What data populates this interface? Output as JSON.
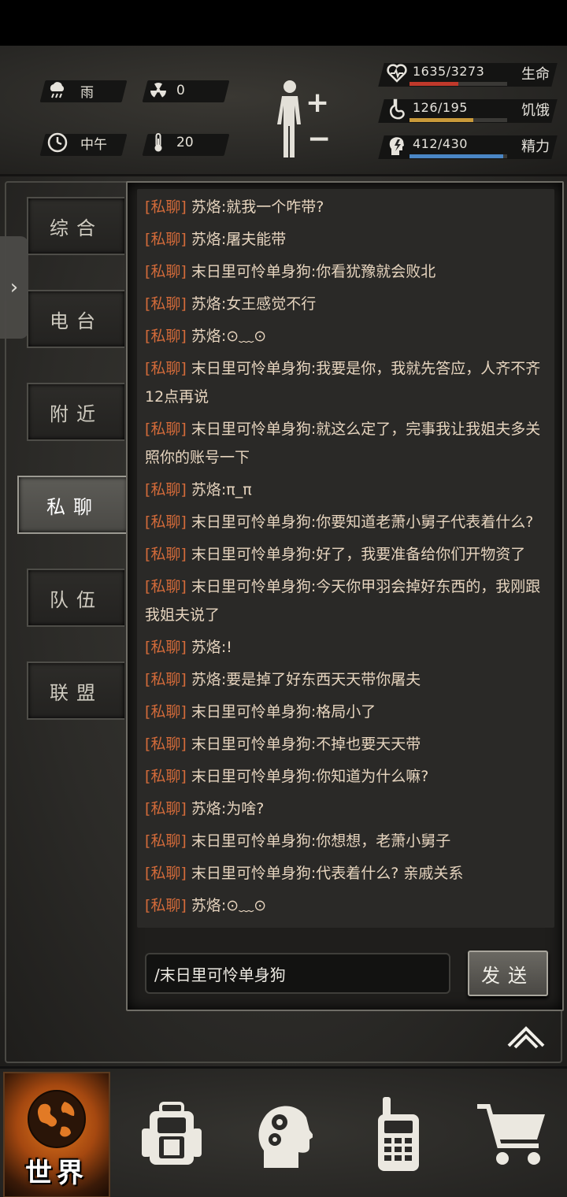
{
  "hud": {
    "weather": {
      "icon": "cloud-rain-icon",
      "value": "雨"
    },
    "radiation": {
      "icon": "radiation-icon",
      "value": "0"
    },
    "time": {
      "icon": "clock-icon",
      "value": "中午"
    },
    "temperature": {
      "icon": "thermometer-icon",
      "value": "20"
    },
    "stats": [
      {
        "key": "health",
        "icon": "heart-icon",
        "value": "1635/3273",
        "label": "生命",
        "fraction": 0.5,
        "color": "#c0392b"
      },
      {
        "key": "hunger",
        "icon": "stomach-icon",
        "value": "126/195",
        "label": "饥饿",
        "fraction": 0.65,
        "color": "#c99a3a"
      },
      {
        "key": "energy",
        "icon": "lightning-head-icon",
        "value": "412/430",
        "label": "精力",
        "fraction": 0.96,
        "color": "#4a86c5"
      }
    ]
  },
  "tabs": [
    {
      "label": "综合",
      "active": false
    },
    {
      "label": "电台",
      "active": false
    },
    {
      "label": "附近",
      "active": false
    },
    {
      "label": "私聊",
      "active": true
    },
    {
      "label": "队伍",
      "active": false
    },
    {
      "label": "联盟",
      "active": false
    }
  ],
  "chat": {
    "messages": [
      {
        "tag": "[私聊]",
        "text": "苏烙:就我一个咋带?"
      },
      {
        "tag": "[私聊]",
        "text": "苏烙:屠夫能带"
      },
      {
        "tag": "[私聊]",
        "text": "末日里可怜单身狗:你看犹豫就会败北"
      },
      {
        "tag": "[私聊]",
        "text": "苏烙:女王感觉不行"
      },
      {
        "tag": "[私聊]",
        "text": "苏烙:⊙﹏⊙"
      },
      {
        "tag": "[私聊]",
        "text": "末日里可怜单身狗:我要是你，我就先答应，人齐不齐12点再说"
      },
      {
        "tag": "[私聊]",
        "text": "末日里可怜单身狗:就这么定了，完事我让我姐夫多关照你的账号一下"
      },
      {
        "tag": "[私聊]",
        "text": "苏烙:π_π"
      },
      {
        "tag": "[私聊]",
        "text": "末日里可怜单身狗:你要知道老萧小舅子代表着什么?"
      },
      {
        "tag": "[私聊]",
        "text": "末日里可怜单身狗:好了，我要准备给你们开物资了"
      },
      {
        "tag": "[私聊]",
        "text": "末日里可怜单身狗:今天你甲羽会掉好东西的，我刚跟我姐夫说了"
      },
      {
        "tag": "[私聊]",
        "text": "苏烙:!"
      },
      {
        "tag": "[私聊]",
        "text": "苏烙:要是掉了好东西天天带你屠夫"
      },
      {
        "tag": "[私聊]",
        "text": "末日里可怜单身狗:格局小了"
      },
      {
        "tag": "[私聊]",
        "text": "末日里可怜单身狗:不掉也要天天带"
      },
      {
        "tag": "[私聊]",
        "text": "末日里可怜单身狗:你知道为什么嘛?"
      },
      {
        "tag": "[私聊]",
        "text": "苏烙:为啥?"
      },
      {
        "tag": "[私聊]",
        "text": "末日里可怜单身狗:你想想，老萧小舅子"
      },
      {
        "tag": "[私聊]",
        "text": "末日里可怜单身狗:代表着什么? 亲戚关系"
      },
      {
        "tag": "[私聊]",
        "text": "苏烙:⊙﹏⊙"
      }
    ],
    "input_value": "/末日里可怜单身狗",
    "send_label": "发送"
  },
  "bottom_nav": [
    {
      "key": "world",
      "label": "世界",
      "icon": "globe-icon",
      "active": true
    },
    {
      "key": "backpack",
      "label": "",
      "icon": "backpack-icon",
      "active": false
    },
    {
      "key": "skills",
      "label": "",
      "icon": "head-gears-icon",
      "active": false
    },
    {
      "key": "radio",
      "label": "",
      "icon": "walkie-talkie-icon",
      "active": false
    },
    {
      "key": "shop",
      "label": "",
      "icon": "shopping-cart-icon",
      "active": false
    }
  ]
}
